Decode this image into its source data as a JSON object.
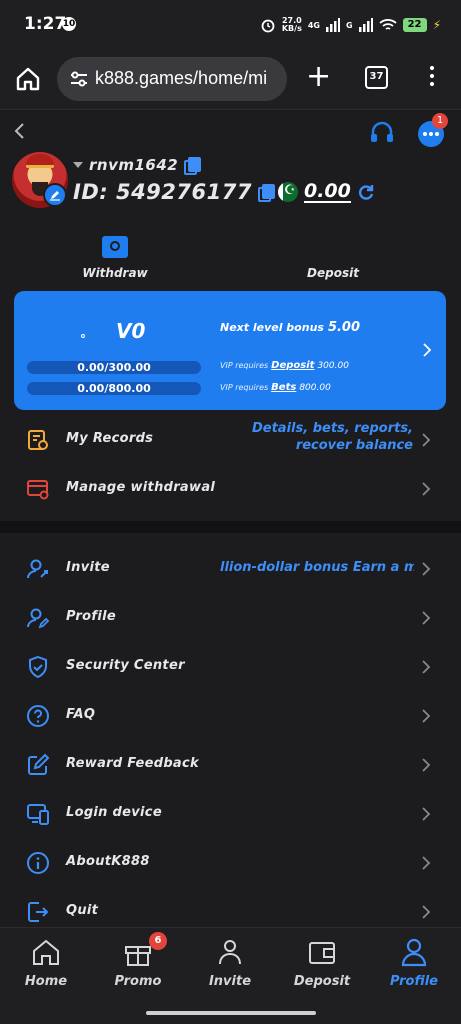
{
  "status_bar": {
    "time": "1:27",
    "notification_count": "10",
    "net_speed_top": "27.0",
    "net_speed_unit": "KB/s",
    "network_4g": "4G",
    "network_g": "G",
    "battery": "22"
  },
  "browser": {
    "url": "k888.games/home/mi",
    "tab_count": "37"
  },
  "header": {
    "chat_badge": "1"
  },
  "profile": {
    "username": "rnvm1642",
    "id_label": "ID: 549276177",
    "balance": "0.00"
  },
  "actions": {
    "withdraw": "Withdraw",
    "deposit": "Deposit"
  },
  "vip": {
    "level": "V0",
    "next_bonus_label": "Next level bonus",
    "next_bonus_value": "5.00",
    "deposit_progress": "0.00/300.00",
    "bets_progress": "0.00/800.00",
    "vip_requires": "VIP requires",
    "deposit_link": "Deposit",
    "deposit_amount": "300.00",
    "bets_link": "Bets",
    "bets_amount": "800.00"
  },
  "records": {
    "my_records": "My Records",
    "my_records_hint_1": "Details, bets, reports,",
    "my_records_hint_2": "recover balance",
    "manage_withdrawal": "Manage withdrawal"
  },
  "menu": {
    "invite": "Invite",
    "invite_marquee": "llion-dollar bonus Earn a m",
    "profile": "Profile",
    "security": "Security Center",
    "faq": "FAQ",
    "reward_feedback": "Reward Feedback",
    "login_device": "Login device",
    "about": "AboutK888",
    "quit": "Quit"
  },
  "bottom_nav": {
    "home": "Home",
    "promo": "Promo",
    "promo_badge": "6",
    "invite": "Invite",
    "deposit": "Deposit",
    "profile": "Profile"
  },
  "colors": {
    "accent": "#1f7df0",
    "background": "#1c1c1e",
    "badge": "#e2453c",
    "records_icon": "#f0a93a",
    "withdrawal_icon": "#e2453c"
  },
  "icons": [
    "home-icon",
    "tune-icon",
    "plus-icon",
    "tabs-icon",
    "menu-icon",
    "back-icon",
    "headset-icon",
    "chat-icon",
    "copy-icon",
    "refresh-icon",
    "pakistan-flag-icon",
    "withdraw-icon",
    "chevron-right-icon",
    "records-icon",
    "withdrawal-card-icon",
    "invite-icon",
    "profile-icon",
    "shield-icon",
    "faq-icon",
    "edit-icon",
    "device-icon",
    "info-icon",
    "quit-icon",
    "gift-icon",
    "wallet-icon",
    "user-icon"
  ]
}
